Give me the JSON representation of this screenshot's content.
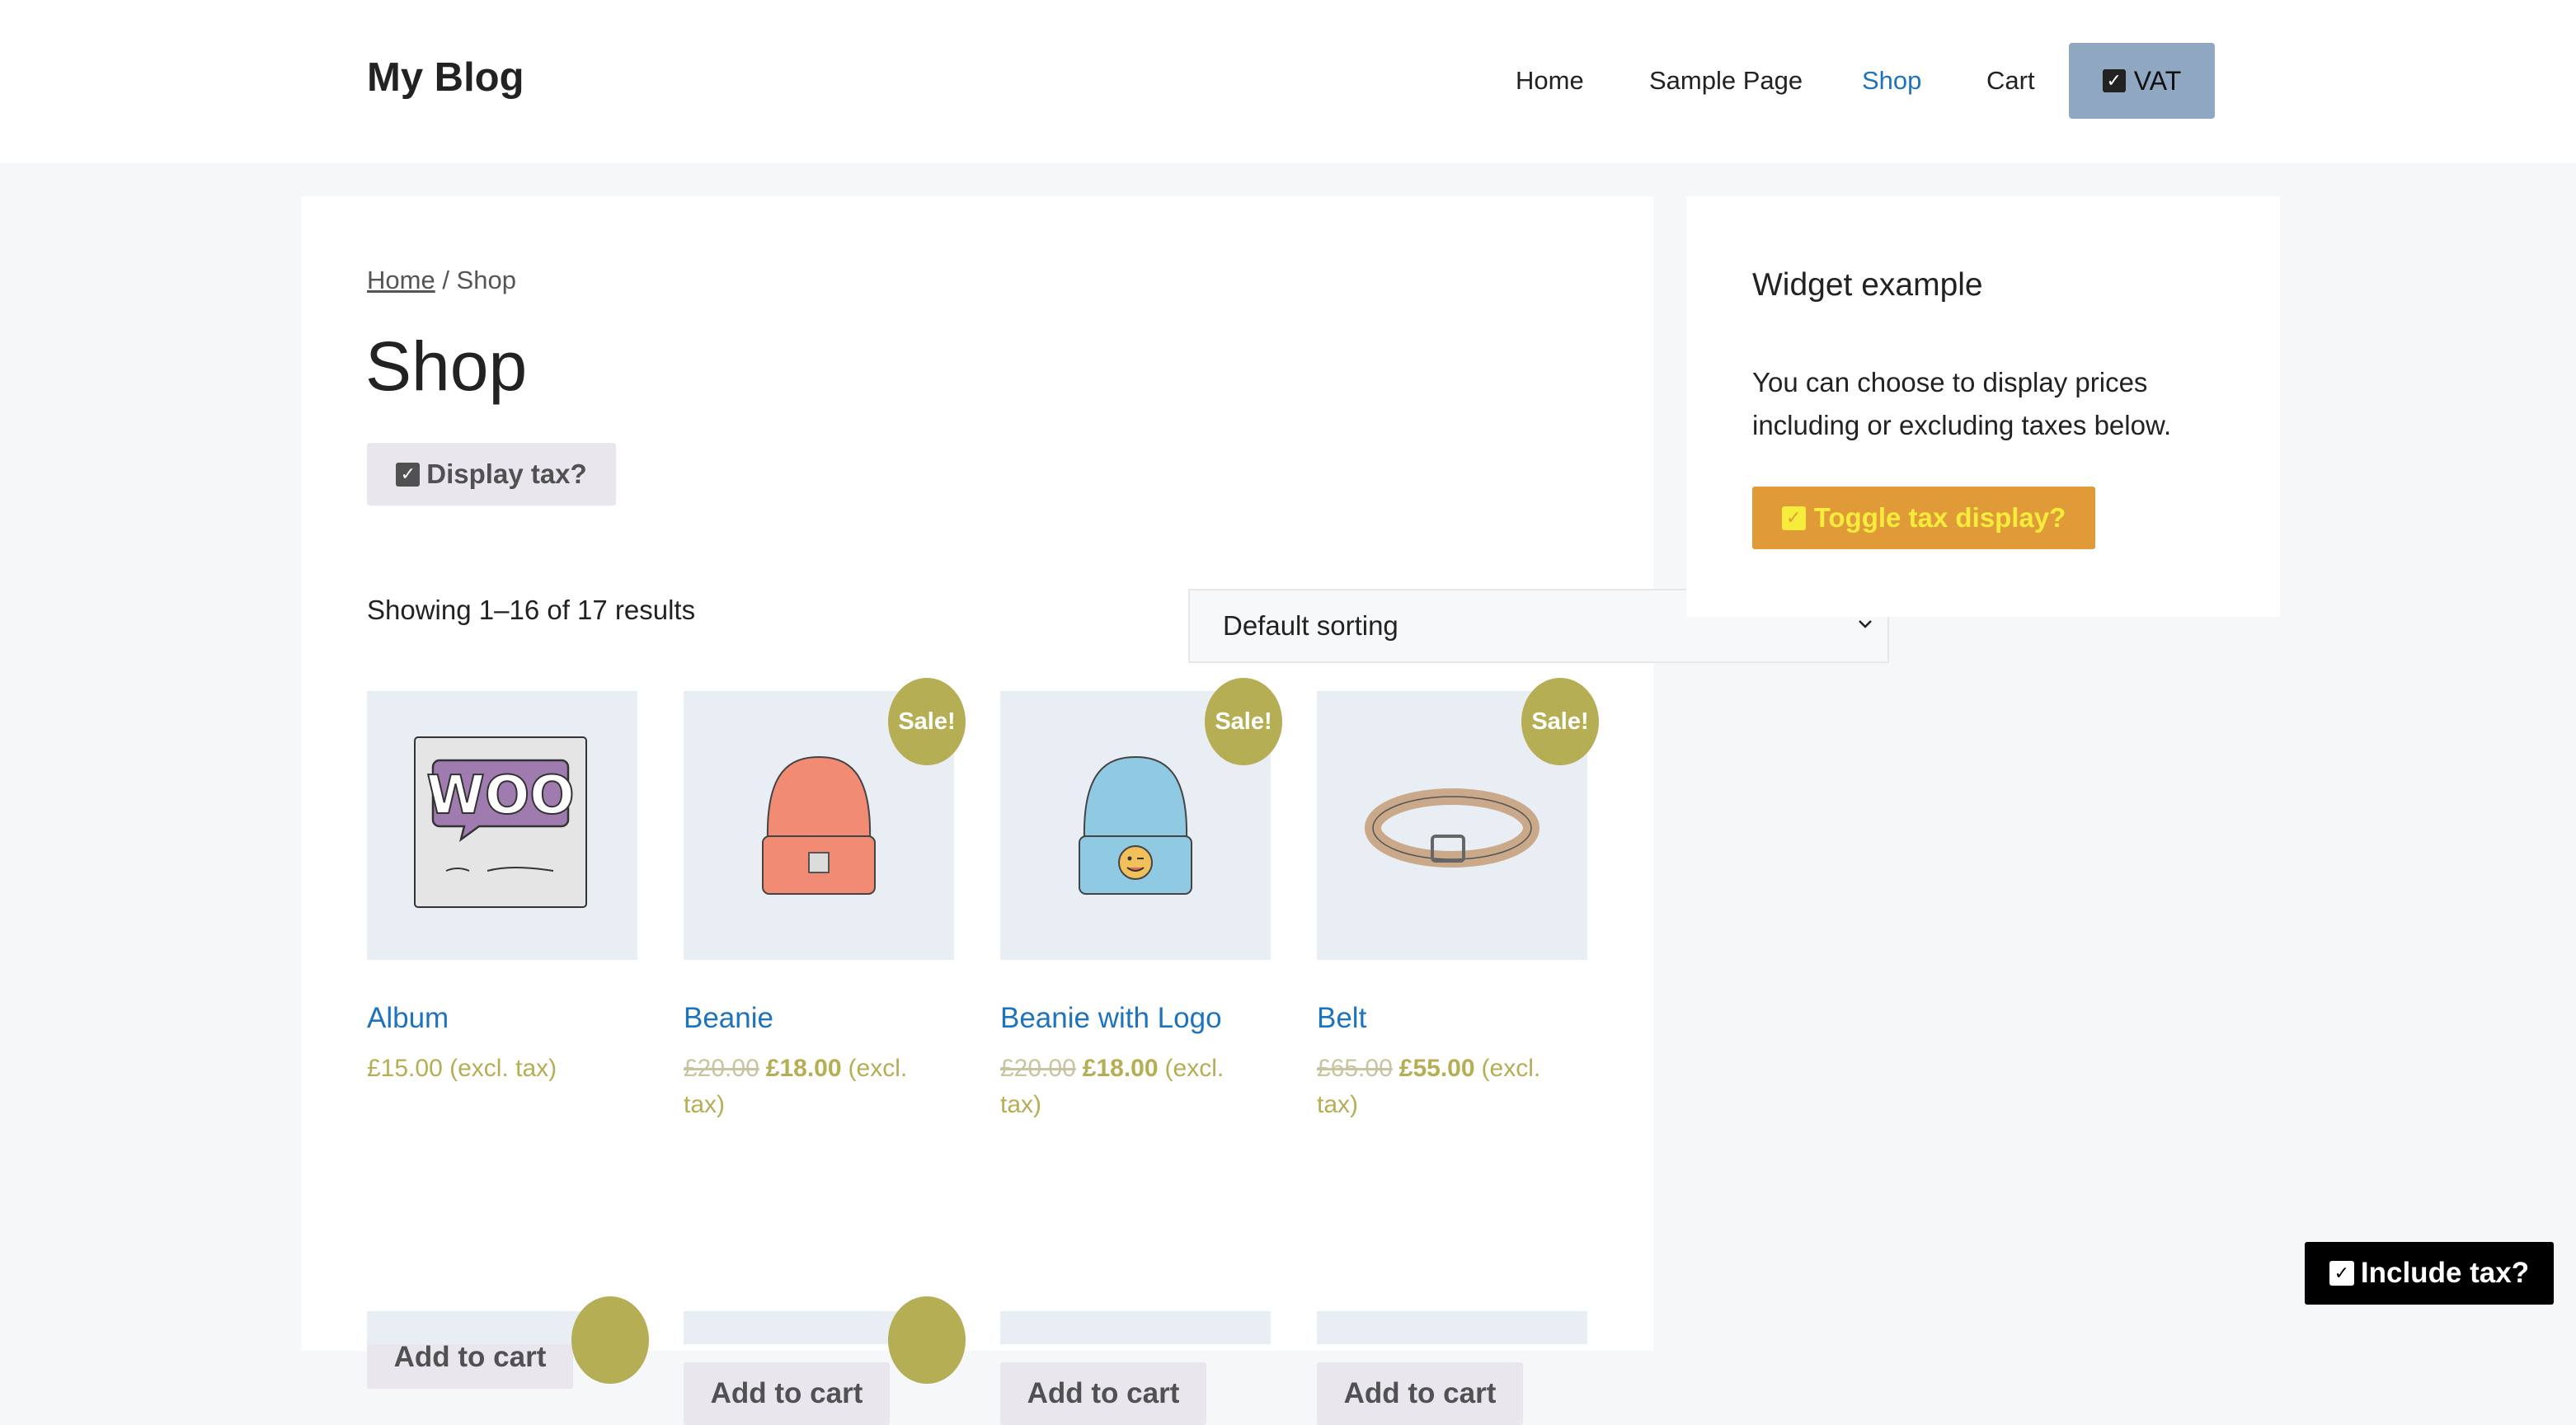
{
  "header": {
    "site_title": "My Blog",
    "nav": [
      "Home",
      "Sample Page",
      "Shop",
      "Cart"
    ],
    "vat_label": "VAT"
  },
  "breadcrumb": {
    "home": "Home",
    "separator": " / ",
    "current": "Shop"
  },
  "page_title": "Shop",
  "display_tax_label": "Display tax?",
  "result_count": "Showing 1–16 of 17 results",
  "sort": {
    "selected": "Default sorting"
  },
  "products": [
    {
      "title": "Album",
      "price": "£15.00",
      "tax_note": "(excl. tax)",
      "button": "Add to cart"
    },
    {
      "title": "Beanie",
      "sale_badge": "Sale!",
      "regular_price": "£20.00",
      "sale_price": "£18.00",
      "tax_note": "(excl. tax)",
      "button": "Add to cart"
    },
    {
      "title": "Beanie with Logo",
      "sale_badge": "Sale!",
      "regular_price": "£20.00",
      "sale_price": "£18.00",
      "tax_note": "(excl. tax)",
      "button": "Add to cart"
    },
    {
      "title": "Belt",
      "sale_badge": "Sale!",
      "regular_price": "£65.00",
      "sale_price": "£55.00",
      "tax_note": "(excl. tax)",
      "button": "Add to cart"
    }
  ],
  "sidebar": {
    "widget_title": "Widget example",
    "widget_text": "You can choose to display prices including or excluding taxes below.",
    "toggle_label": "Toggle tax display?"
  },
  "floating_button": {
    "label": "Include tax?"
  },
  "colors": {
    "link": "#1e73be",
    "price": "#b6ae54",
    "sale_badge": "#b6ae54",
    "vat_button": "#8fa7c1",
    "toggle_button": "#e09a38",
    "toggle_text": "#f6ec3b",
    "include_tax_button": "#000000"
  }
}
